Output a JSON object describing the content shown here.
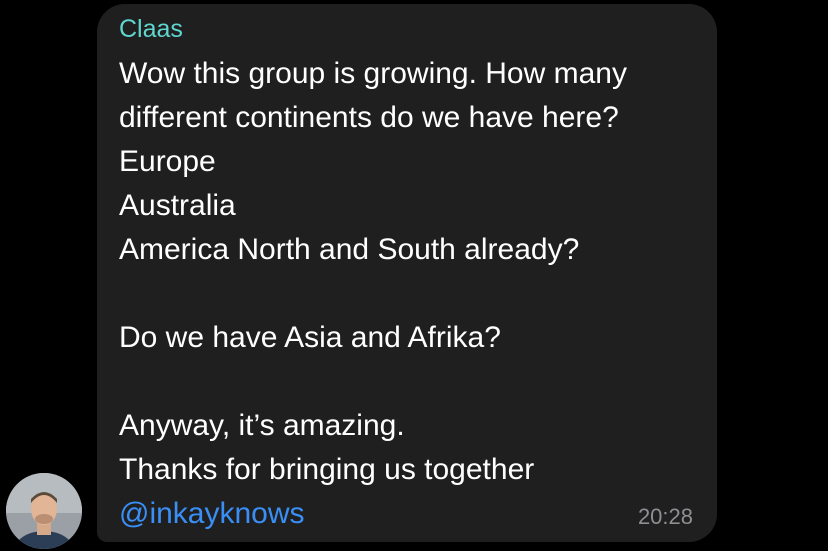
{
  "message": {
    "sender": "Claas",
    "lines": [
      "Wow this group is growing. How many",
      "different continents do we have here?",
      "Europe",
      "Australia",
      "America North and South already?",
      "",
      "Do we have Asia and Afrika?",
      "",
      "Anyway, it’s amazing.",
      "Thanks for bringing us together"
    ],
    "mention": "@inkayknows",
    "time": "20:28"
  },
  "colors": {
    "background": "#000000",
    "bubble": "#1f1f1f",
    "sender_name": "#5fd6d0",
    "text": "#ffffff",
    "mention": "#3a8ff7",
    "timestamp": "#8e8e93"
  }
}
